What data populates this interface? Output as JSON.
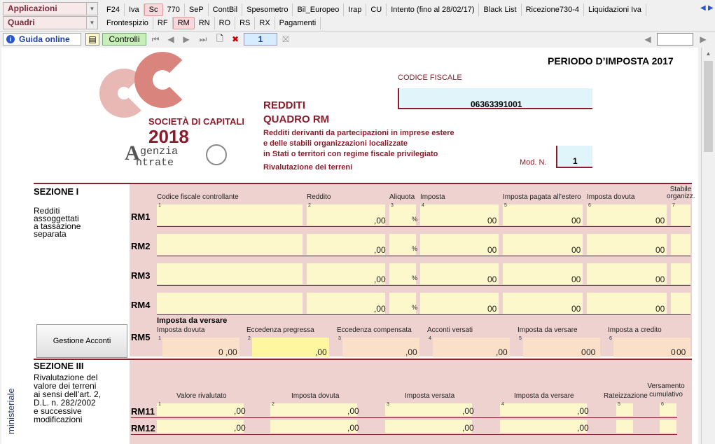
{
  "menu": {
    "applicazioni": "Applicazioni",
    "quadri": "Quadri"
  },
  "tabs_row1": [
    "F24",
    "Iva",
    "Sc",
    "770",
    "SeP",
    "ContBil",
    "Spesometro",
    "Bil_Europeo",
    "Irap",
    "CU",
    "Intento (fino al 28/02/17)",
    "Black List",
    "Ricezione730-4",
    "Liquidazioni Iva"
  ],
  "tabs_row2": [
    "Frontespizio",
    "RF",
    "RM",
    "RN",
    "RO",
    "RS",
    "RX",
    "Pagamenti"
  ],
  "toolbar": {
    "guida": "Guida online",
    "controlli": "Controlli",
    "page": "1"
  },
  "header": {
    "periodo": "PERIODO D’IMPOSTA 2017",
    "codice_label": "CODICE FISCALE",
    "codice": "06363391001",
    "redditi": "REDDITI",
    "quadro": "QUADRO RM",
    "desc1": "Redditi derivanti da partecipazioni in imprese estere",
    "desc2": "e delle stabili organizzazioni localizzate",
    "desc3": "in Stati o territori con regime fiscale privilegiato",
    "desc4": "Rivalutazione dei terreni",
    "mod_label": "Mod. N.",
    "mod": "1"
  },
  "logo": {
    "company": "SOCIETÀ DI CAPITALI",
    "year": "2018",
    "agenzia": "genzia",
    "entrate": "ntrate"
  },
  "sez1": {
    "title": "SEZIONE I",
    "desc1": "Redditi",
    "desc2": "assoggettati",
    "desc3": "a tassazione",
    "desc4": "separata",
    "cols": [
      "Codice fiscale controllante",
      "Reddito",
      "Aliquota",
      "Imposta",
      "Imposta pagata all’estero",
      "Imposta dovuta",
      "Stabile organizz."
    ],
    "rows": [
      "RM1",
      "RM2",
      "RM3",
      "RM4"
    ]
  },
  "rm5": {
    "row": "RM5",
    "title": "Imposta da versare",
    "cols": [
      "Imposta dovuta",
      "Eccedenza pregressa",
      "Eccedenza compensata",
      "Acconti versati",
      "Imposta da versare",
      "Imposta a credito"
    ],
    "v1": "0",
    "v5": "0",
    "v6": "0"
  },
  "gestione": "Gestione Acconti",
  "sez3": {
    "title": "SEZIONE III",
    "desc1": "Rivalutazione del",
    "desc2": "valore dei terreni",
    "desc3": "ai sensi dell’art. 2,",
    "desc4": "D.L. n. 282/2002",
    "desc5": "e successive",
    "desc6": "modificazioni",
    "cols": [
      "Valore rivalutato",
      "Imposta dovuta",
      "Imposta versata",
      "Imposta da versare",
      "Rateizzazione",
      "Versamento cumulativo"
    ],
    "rows": [
      "RM11",
      "RM12"
    ]
  },
  "side": "ministeriale",
  "oo": ",00",
  "oo_plain": "00",
  "pct": "%",
  "nums": [
    "1",
    "2",
    "3",
    "4",
    "5",
    "6",
    "7"
  ]
}
